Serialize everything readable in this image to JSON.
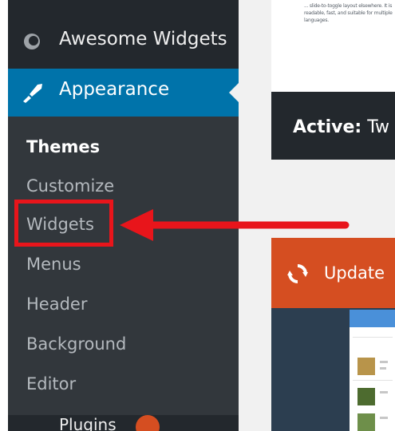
{
  "sidebar": {
    "top_item": {
      "label": "Awesome Widgets",
      "icon": "plugin-icon"
    },
    "active_item": {
      "label": "Appearance",
      "icon": "paintbrush-icon"
    },
    "submenu": [
      {
        "label": "Themes",
        "current": true
      },
      {
        "label": "Customize"
      },
      {
        "label": "Widgets",
        "highlighted": true
      },
      {
        "label": "Menus"
      },
      {
        "label": "Header"
      },
      {
        "label": "Background"
      },
      {
        "label": "Editor"
      }
    ],
    "bottom_item": {
      "label": "Plugins",
      "icon": "plugins-icon"
    }
  },
  "main": {
    "theme_description": "... slide-to-toggle layout elsewhere. It is readable, fast, and suitable for multiple languages.",
    "active_bar": {
      "prefix": "Active:",
      "name": "Tw"
    },
    "update_bar": {
      "label": "Update",
      "icon": "update-icon"
    }
  },
  "colors": {
    "sidebar": "#32373c",
    "sidebar_dark": "#23282d",
    "accent": "#0073aa",
    "annotation_red": "#e8151b",
    "update_orange": "#d54e21"
  }
}
